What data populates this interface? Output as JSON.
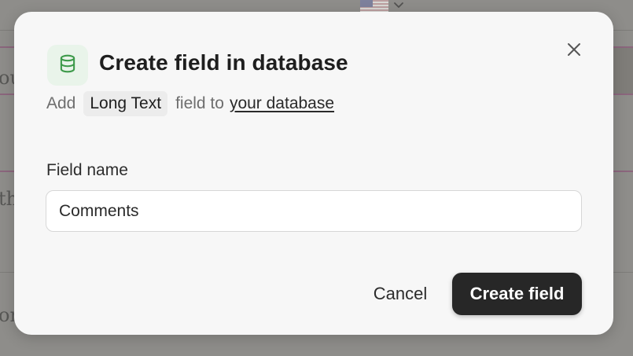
{
  "modal": {
    "title": "Create field in database",
    "subtitle": {
      "prefix": "Add",
      "field_type": "Long Text",
      "middle": "field to",
      "link": "your database"
    },
    "field_label": "Field name",
    "field_value": "Comments",
    "cancel_label": "Cancel",
    "create_label": "Create field",
    "icons": {
      "header": "database-icon",
      "close": "close-icon"
    }
  },
  "background": {
    "text_fragments": [
      "ou",
      "th",
      "or"
    ],
    "flag": "us-flag-icon"
  },
  "colors": {
    "primary_button": "#272727",
    "icon_accent": "#3d9a4a",
    "icon_bg": "#e9f4ea",
    "overlay": "#8e8d8a"
  }
}
